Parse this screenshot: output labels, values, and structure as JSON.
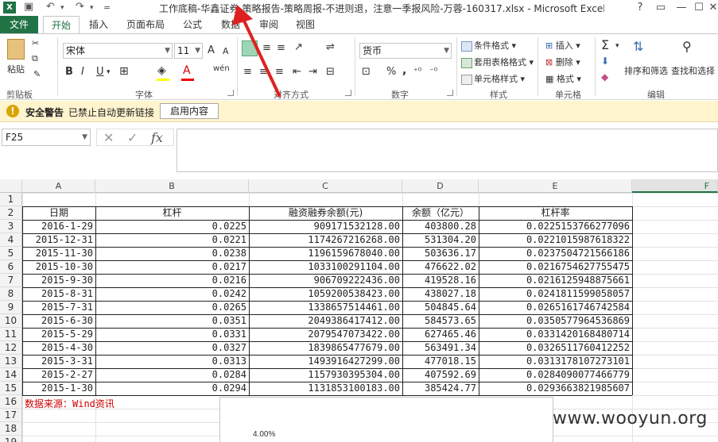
{
  "window": {
    "title": "工作底稿-华鑫证券-策略报告-策略周报-不进则退，注意一季报风险-万蓉-160317.xlsx - Microsoft Excel",
    "controls": [
      "?",
      "▭",
      "—",
      "☐",
      "✕"
    ]
  },
  "tabs": [
    "文件",
    "开始",
    "插入",
    "页面布局",
    "公式",
    "数据",
    "审阅",
    "视图"
  ],
  "ribbon": {
    "clipboard": {
      "label": "剪贴板",
      "paste": "粘贴"
    },
    "font": {
      "label": "字体",
      "name": "宋体",
      "size": "11",
      "bold": "B",
      "italic": "I",
      "underline": "U",
      "grow": "A",
      "shrink": "A",
      "phonetic": "wén"
    },
    "alignment": {
      "label": "对齐方式"
    },
    "number": {
      "label": "数字",
      "format": "货币",
      "percent": "%",
      "comma": ","
    },
    "styles": {
      "label": "样式",
      "conditional": "条件格式",
      "table": "套用表格格式",
      "cell": "单元格样式"
    },
    "cells": {
      "label": "单元格",
      "insert": "插入",
      "delete": "删除",
      "format": "格式"
    },
    "editing": {
      "label": "编辑",
      "sort": "排序和筛选",
      "find": "查找和选择"
    }
  },
  "security": {
    "title": "安全警告",
    "message": "已禁止自动更新链接",
    "button": "启用内容"
  },
  "formula_bar": {
    "name_box": "F25",
    "cancel": "✕",
    "enter": "✓",
    "fx": "fx",
    "formula": ""
  },
  "columns": [
    "A",
    "B",
    "C",
    "D",
    "E",
    "F"
  ],
  "rows": [
    "1",
    "2",
    "3",
    "4",
    "5",
    "6",
    "7",
    "8",
    "9",
    "10",
    "11",
    "12",
    "13",
    "14",
    "15",
    "16",
    "17",
    "18",
    "19"
  ],
  "table": {
    "headers": [
      "日期",
      "杠杆",
      "融资融券余额(元)",
      "余额（亿元）",
      "杠杆率"
    ],
    "data": [
      [
        "2016-1-29",
        "0.0225",
        "909171532128.00",
        "403800.28",
        "0.0225153766277096"
      ],
      [
        "2015-12-31",
        "0.0221",
        "1174267216268.00",
        "531304.20",
        "0.0221015987618322"
      ],
      [
        "2015-11-30",
        "0.0238",
        "1196159678040.00",
        "503636.17",
        "0.0237504721566186"
      ],
      [
        "2015-10-30",
        "0.0217",
        "1033100291104.00",
        "476622.02",
        "0.0216754627755475"
      ],
      [
        "2015-9-30",
        "0.0216",
        "906709222436.00",
        "419528.16",
        "0.0216125948875661"
      ],
      [
        "2015-8-31",
        "0.0242",
        "1059200538423.00",
        "438027.18",
        "0.0241811599058057"
      ],
      [
        "2015-7-31",
        "0.0265",
        "1338657514461.00",
        "504845.64",
        "0.0265161746742584"
      ],
      [
        "2015-6-30",
        "0.0351",
        "2049386417412.00",
        "584573.65",
        "0.0350577964536869"
      ],
      [
        "2015-5-29",
        "0.0331",
        "2079547073422.00",
        "627465.46",
        "0.0331420168480714"
      ],
      [
        "2015-4-30",
        "0.0327",
        "1839865477679.00",
        "563491.34",
        "0.0326511760412252"
      ],
      [
        "2015-3-31",
        "0.0313",
        "1493916427299.00",
        "477018.15",
        "0.0313178107273101"
      ],
      [
        "2015-2-27",
        "0.0284",
        "1157930395304.00",
        "407592.69",
        "0.0284090077466779"
      ],
      [
        "2015-1-30",
        "0.0294",
        "1131853100183.00",
        "385424.77",
        "0.0293663821985607"
      ]
    ]
  },
  "source_note": "数据来源：Wind资讯",
  "chart": {
    "axis_tick": "4.00%"
  },
  "watermark": "www.wooyun.org"
}
